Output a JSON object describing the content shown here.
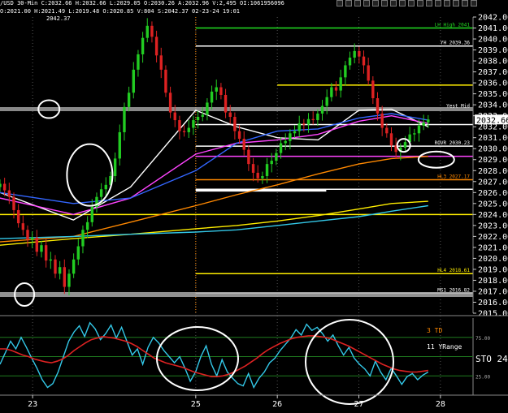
{
  "header": {
    "line1": "/USD 30-Min  C:2032.66 H:2032.66 L:2029.05 O:2030.26 A:2032.96 V:2,495 OI:1061956096",
    "line2": "O:2021.00 H:2021.49 L:2019.48 O:2020.85 V:804 S:2042.37 02-23-24 19:01",
    "peak_label": "2042.37"
  },
  "colors": {
    "background": "#000000",
    "price_label_bg": "#ffffff",
    "up_candle": "#22cc22",
    "down_candle": "#dd2222",
    "oscillator": "#33c8e8",
    "signal": "#dd2222",
    "yellow": "#ffee00",
    "magenta": "#ff44ff",
    "orange": "#ff8800",
    "gray_band": "#aaaaaa"
  },
  "chart_data": {
    "type": "line",
    "symbol_interval": "30-Min",
    "price_axis": {
      "ylim": [
        2015,
        2042
      ],
      "ticks": [
        "2042.00",
        "2041.00",
        "2040.00",
        "2039.00",
        "2038.00",
        "2037.00",
        "2036.00",
        "2035.00",
        "2034.00",
        "2033.00",
        "2032.00",
        "2031.00",
        "2030.00",
        "2029.00",
        "2028.00",
        "2027.00",
        "2026.00",
        "2025.00",
        "2024.00",
        "2023.00",
        "2022.00",
        "2021.00",
        "2020.00",
        "2019.00",
        "2018.00",
        "2017.00",
        "2016.00",
        "2015.00"
      ],
      "current_price": "2032.66"
    },
    "x_axis": {
      "range": [
        22.6,
        28.4
      ],
      "ticks": [
        {
          "x": 23,
          "label": "23"
        },
        {
          "x": 25,
          "label": "25"
        },
        {
          "x": 26,
          "label": "26"
        },
        {
          "x": 27,
          "label": "27"
        },
        {
          "x": 28,
          "label": "28"
        }
      ]
    },
    "candles": {
      "x_start": 22.6,
      "x_end": 27.85,
      "closes": [
        2026.8,
        2026.2,
        2025.6,
        2024.4,
        2023.2,
        2022.6,
        2021.7,
        2021.9,
        2020.6,
        2021.2,
        2019.8,
        2019.9,
        2018.6,
        2019.2,
        2017.4,
        2018.6,
        2019.9,
        2021.1,
        2022.6,
        2023.3,
        2024.7,
        2025.6,
        2026.3,
        2026.7,
        2027.5,
        2029.1,
        2031.5,
        2033.8,
        2035.1,
        2037.2,
        2038.6,
        2040.1,
        2041.2,
        2040.2,
        2038.5,
        2037.2,
        2035.1,
        2033.3,
        2032.6,
        2031.6,
        2031.5,
        2031.9,
        2032.6,
        2032.9,
        2033.1,
        2034.2,
        2035.2,
        2035.6,
        2034.9,
        2033.3,
        2032.9,
        2031.6,
        2030.9,
        2029.9,
        2028.6,
        2027.8,
        2027.3,
        2027.5,
        2028.6,
        2028.9,
        2029.6,
        2030.5,
        2030.7,
        2031.4,
        2031.6,
        2032.3,
        2032.2,
        2032.7,
        2032.6,
        2033.2,
        2033.9,
        2034.7,
        2035.6,
        2035.3,
        2036.5,
        2037.6,
        2038.3,
        2038.9,
        2038.4,
        2037.6,
        2036.2,
        2034.6,
        2033.2,
        2031.9,
        2031.4,
        2030.3,
        2029.7,
        2030.1,
        2030.6,
        2031.3,
        2031.4,
        2032.1,
        2032.4,
        2032.66
      ]
    },
    "levels": [
      {
        "label": "LH High 2041",
        "value": 2041.0,
        "color": "#22dd22",
        "x_from": 25.0
      },
      {
        "label": "YH 2039.36",
        "value": 2039.36,
        "color": "#ffffff",
        "x_from": 25.0
      },
      {
        "label": "Yest Mid",
        "value": 2033.6,
        "color": "#aaaaaa"
      },
      {
        "label": "ROVR 2030.23",
        "value": 2030.23,
        "color": "#ffffff",
        "x_from": 25.0
      },
      {
        "label": "HL3 2027.17",
        "value": 2027.17,
        "color": "#ff8800",
        "x_from": 25.0
      },
      {
        "label": "HL4 2018.61",
        "value": 2018.61,
        "color": "#ffee00",
        "x_from": 25.0
      },
      {
        "label": "MS1 2016.82",
        "value": 2016.82,
        "color": "#ffffff",
        "x_from": 25.0
      },
      {
        "label": "",
        "value": 2035.8,
        "color": "#ffee00",
        "x_from": 26.0
      },
      {
        "label": "",
        "value": 2032.2,
        "color": "#ffffff",
        "x_from": 25.0
      },
      {
        "label": "",
        "value": 2029.3,
        "color": "#ff44ff",
        "x_from": 25.0
      },
      {
        "label": "",
        "value": 2026.3,
        "color": "#ffffff",
        "x_from": 25.0
      },
      {
        "label": "",
        "value": 2024.0,
        "color": "#ffee00",
        "x_from": 22.6
      }
    ],
    "moving_averages": [
      {
        "color": "#ffffff",
        "x": [
          22.6,
          23.5,
          24.2,
          25.0,
          25.5,
          26.0,
          26.5,
          27.0,
          27.4,
          27.85
        ],
        "y": [
          2026.0,
          2023.5,
          2026.5,
          2033.5,
          2032.0,
          2031.0,
          2030.8,
          2033.5,
          2033.6,
          2032.0
        ]
      },
      {
        "color": "#ff44ff",
        "x": [
          22.6,
          23.5,
          24.2,
          25.0,
          25.5,
          26.0,
          26.5,
          27.0,
          27.4,
          27.85
        ],
        "y": [
          2025.5,
          2024.0,
          2025.5,
          2029.5,
          2030.5,
          2030.8,
          2031.3,
          2032.5,
          2033.0,
          2032.3
        ]
      },
      {
        "color": "#3366ff",
        "x": [
          22.6,
          23.5,
          24.2,
          25.0,
          25.5,
          26.0,
          26.5,
          27.0,
          27.4,
          27.85
        ],
        "y": [
          2026.0,
          2025.0,
          2025.5,
          2028.0,
          2030.5,
          2031.6,
          2031.8,
          2032.8,
          2033.2,
          2032.6
        ]
      },
      {
        "color": "#ff8800",
        "x": [
          22.6,
          23.5,
          24.2,
          25.0,
          25.5,
          26.0,
          26.5,
          27.0,
          27.4,
          27.85
        ],
        "y": [
          2021.5,
          2022.0,
          2023.3,
          2024.8,
          2025.8,
          2026.7,
          2027.7,
          2028.6,
          2029.1,
          2029.3
        ]
      },
      {
        "color": "#ffee00",
        "x": [
          22.6,
          23.5,
          24.2,
          25.0,
          25.5,
          26.0,
          26.5,
          27.0,
          27.4,
          27.85
        ],
        "y": [
          2021.2,
          2021.8,
          2022.2,
          2022.7,
          2023.0,
          2023.4,
          2023.9,
          2024.5,
          2025.0,
          2025.2
        ]
      },
      {
        "color": "#33c8e8",
        "x": [
          22.6,
          23.5,
          24.2,
          25.0,
          25.5,
          26.0,
          26.5,
          27.0,
          27.4,
          27.85
        ],
        "y": [
          2021.8,
          2022.0,
          2022.2,
          2022.4,
          2022.6,
          2023.0,
          2023.4,
          2023.8,
          2024.3,
          2024.8
        ]
      }
    ],
    "oscillator": {
      "labels": [
        "3 TD",
        "11 YRange",
        "STO 24."
      ],
      "ticks": [
        {
          "value": 75,
          "label": "75.00"
        },
        {
          "value": 25,
          "label": "25.00"
        }
      ],
      "ylim": [
        0,
        100
      ],
      "sto": [
        40,
        55,
        70,
        60,
        75,
        62,
        48,
        35,
        20,
        10,
        15,
        30,
        50,
        70,
        82,
        90,
        76,
        94,
        86,
        72,
        80,
        91,
        74,
        88,
        70,
        52,
        60,
        40,
        62,
        75,
        68,
        58,
        50,
        42,
        50,
        35,
        18,
        30,
        50,
        64,
        40,
        25,
        46,
        30,
        22,
        15,
        12,
        28,
        10,
        22,
        30,
        42,
        48,
        58,
        66,
        74,
        85,
        78,
        92,
        84,
        88,
        80,
        70,
        78,
        64,
        52,
        62,
        48,
        40,
        34,
        25,
        44,
        30,
        20,
        35,
        25,
        14,
        24,
        28,
        20,
        26,
        30
      ],
      "signal": [
        60,
        60,
        58,
        55,
        52,
        50,
        47,
        45,
        43,
        42,
        44,
        47,
        52,
        58,
        63,
        68,
        72,
        74,
        76,
        75,
        74,
        72,
        70,
        67,
        63,
        58,
        53,
        48,
        45,
        42,
        40,
        38,
        36,
        33,
        30,
        28,
        26,
        24,
        24,
        25,
        27,
        30,
        34,
        38,
        43,
        48,
        54,
        59,
        63,
        67,
        70,
        73,
        75,
        76,
        77,
        77,
        76,
        75,
        73,
        70,
        67,
        64,
        60,
        56,
        52,
        48,
        44,
        40,
        37,
        34,
        32,
        31,
        30,
        30,
        31,
        32
      ]
    },
    "annotations": [
      {
        "type": "circle",
        "x": 23.2,
        "y": 2033.6
      },
      {
        "type": "circle",
        "x": 23.7,
        "y": 2027.6
      },
      {
        "type": "circle",
        "x": 22.9,
        "y": 2016.7
      },
      {
        "type": "circle",
        "x": 27.55,
        "y": 2030.3
      },
      {
        "type": "circle",
        "x": 27.95,
        "y": 2029.0
      }
    ]
  }
}
